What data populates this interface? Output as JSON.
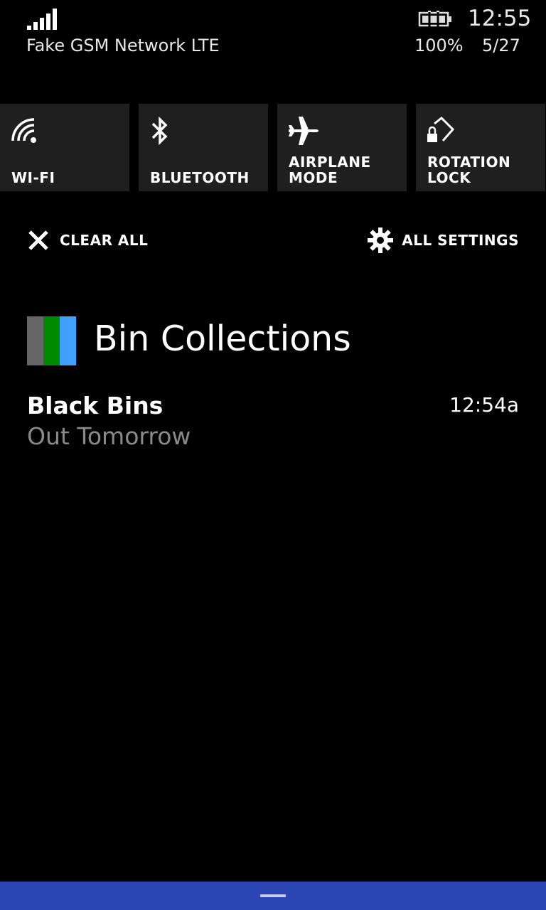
{
  "status_bar": {
    "carrier": "Fake GSM Network LTE",
    "time": "12:55",
    "battery_percent": "100%",
    "date": "5/27",
    "signal_icon": "signal-bars-icon",
    "battery_icon": "battery-charging-icon"
  },
  "quick_actions": [
    {
      "label": "WI-FI",
      "icon": "wifi-icon"
    },
    {
      "label": "BLUETOOTH",
      "icon": "bluetooth-icon"
    },
    {
      "label": "AIRPLANE\nMODE",
      "icon": "airplane-icon"
    },
    {
      "label": "ROTATION LOCK",
      "icon": "rotation-lock-icon"
    }
  ],
  "actions": {
    "clear_all": "CLEAR ALL",
    "all_settings": "ALL SETTINGS"
  },
  "notification_group": {
    "app_name": "Bin Collections",
    "logo_colors": [
      "#666666",
      "#008a00",
      "#3fa0ff"
    ],
    "notifications": [
      {
        "title": "Black Bins",
        "time": "12:54a",
        "body": "Out Tomorrow"
      }
    ]
  },
  "colors": {
    "tile_background": "#1f1f1f",
    "bottom_bar": "#2b45b4"
  }
}
